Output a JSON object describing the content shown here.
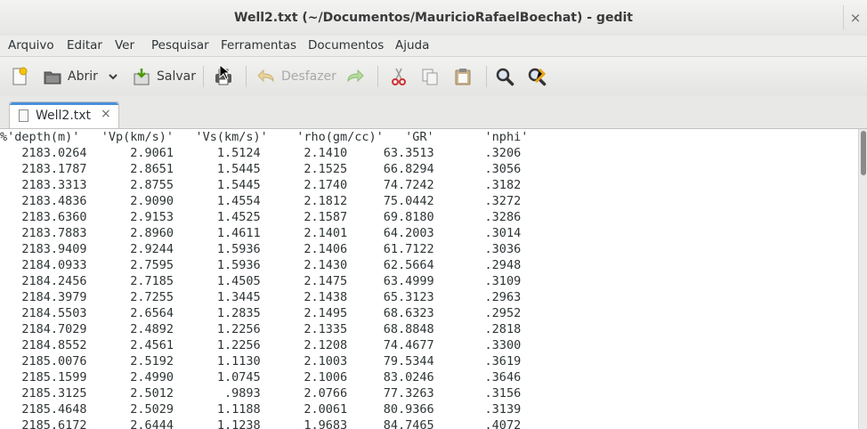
{
  "window": {
    "title": "Well2.txt (~/Documentos/MauricioRafaelBoechat) - gedit",
    "close": "×"
  },
  "menu": [
    "Arquivo",
    "Editar",
    "Ver",
    "Pesquisar",
    "Ferramentas",
    "Documentos",
    "Ajuda"
  ],
  "toolbar": {
    "open": "Abrir",
    "save": "Salvar",
    "undo": "Desfazer"
  },
  "tab": {
    "label": "Well2.txt",
    "close": "×"
  },
  "editor": {
    "lines": [
      "%'depth(m)'   'Vp(km/s)'   'Vs(km/s)'    'rho(gm/cc)'   'GR'       'nphi'",
      "   2183.0264      2.9061      1.5124      2.1410     63.3513       .3206",
      "   2183.1787      2.8651      1.5445      2.1525     66.8294       .3056",
      "   2183.3313      2.8755      1.5445      2.1740     74.7242       .3182",
      "   2183.4836      2.9090      1.4554      2.1812     75.0442       .3272",
      "   2183.6360      2.9153      1.4525      2.1587     69.8180       .3286",
      "   2183.7883      2.8960      1.4611      2.1401     64.2003       .3014",
      "   2183.9409      2.9244      1.5936      2.1406     61.7122       .3036",
      "   2184.0933      2.7595      1.5936      2.1430     62.5664       .2948",
      "   2184.2456      2.7185      1.4505      2.1475     63.4999       .3109",
      "   2184.3979      2.7255      1.3445      2.1438     65.3123       .2963",
      "   2184.5503      2.6564      1.2835      2.1495     68.6323       .2952",
      "   2184.7029      2.4892      1.2256      2.1335     68.8848       .2818",
      "   2184.8552      2.4561      1.2256      2.1208     74.4677       .3300",
      "   2185.0076      2.5192      1.1130      2.1003     79.5344       .3619",
      "   2185.1599      2.4990      1.0745      2.1006     83.0246       .3646",
      "   2185.3125      2.5012       .9893      2.0766     77.3263       .3156",
      "   2185.4648      2.5029      1.1188      2.0061     80.9366       .3139",
      "   2185.6172      2.6444      1.1238      1.9683     84.7465       .4072"
    ]
  }
}
